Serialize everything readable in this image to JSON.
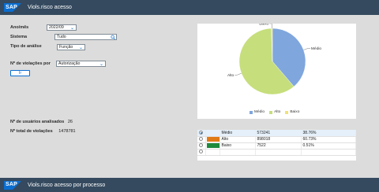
{
  "header": {
    "logo": "SAP",
    "title": "Viols.risco acesso"
  },
  "footer": {
    "logo": "SAP",
    "title": "Viols.risco acesso por processo"
  },
  "form": {
    "period_label": "Ano/mês",
    "period_value": "2022/09",
    "system_label": "Sistema",
    "system_value": "Tudo",
    "analysis_label": "Tipo de análise",
    "analysis_value": "Função",
    "violations_label": "Nº de violações por",
    "violations_value": "Autorização",
    "go_button": "Ir"
  },
  "stats": {
    "users_label": "Nº de usuários analisados",
    "users_value": "26",
    "violations_label": "Nº total de violações",
    "violations_value": "1478781"
  },
  "colors": {
    "medio": "#7fa6dd",
    "alto": "#c6de7c",
    "baixo": "#f0e07a",
    "alto_box": "#e07b17",
    "baixo_box": "#1e8a3c"
  },
  "chart_data": {
    "type": "pie",
    "categories": [
      "Médio",
      "Alto",
      "Baixo"
    ],
    "values": [
      573241,
      898018,
      7522
    ],
    "legend": [
      "Médio",
      "Alto",
      "Baixo"
    ],
    "legend_position": "bottom"
  },
  "table": {
    "rows": [
      {
        "category": "Médio",
        "count": "573241",
        "percent": "38.76%",
        "selected": true,
        "box": ""
      },
      {
        "category": "Alto",
        "count": "898018",
        "percent": "60.73%",
        "selected": false,
        "box": "alto_box"
      },
      {
        "category": "Baixo",
        "count": "7522",
        "percent": "0.51%",
        "selected": false,
        "box": "baixo_box"
      },
      {
        "category": "",
        "count": "",
        "percent": "",
        "selected": false,
        "box": ""
      }
    ]
  }
}
